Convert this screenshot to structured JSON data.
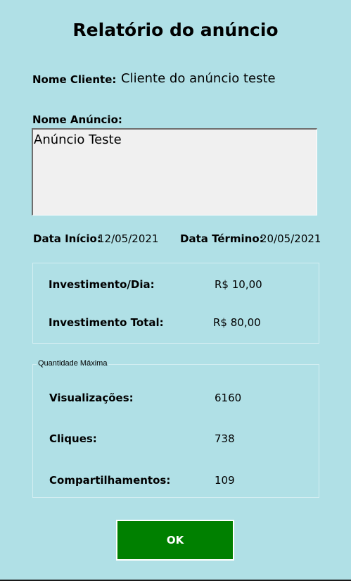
{
  "window": {
    "title": "Relatório do anúncio"
  },
  "client": {
    "label": "Nome Cliente:",
    "value": "Cliente do anúncio teste"
  },
  "ad": {
    "label": "Nome Anúncio:",
    "value": "Anúncio Teste"
  },
  "dates": {
    "start_label": "Data Início:",
    "start_value": "12/05/2021",
    "end_label": "Data Término:",
    "end_value": "20/05/2021"
  },
  "investment": {
    "daily_label": "Investimento/Dia:",
    "daily_value": "R$ 10,00",
    "total_label": "Investimento Total:",
    "total_value": "R$ 80,00"
  },
  "max_quantity": {
    "legend": "Quantidade Máxima",
    "views_label": "Visualizações:",
    "views_value": "6160",
    "clicks_label": "Cliques:",
    "clicks_value": "738",
    "shares_label": "Compartilhamentos:",
    "shares_value": "109"
  },
  "actions": {
    "ok_label": "OK"
  },
  "colors": {
    "background": "#b0e0e6",
    "ok_button": "#008000",
    "textbox": "#f0f0f0"
  }
}
